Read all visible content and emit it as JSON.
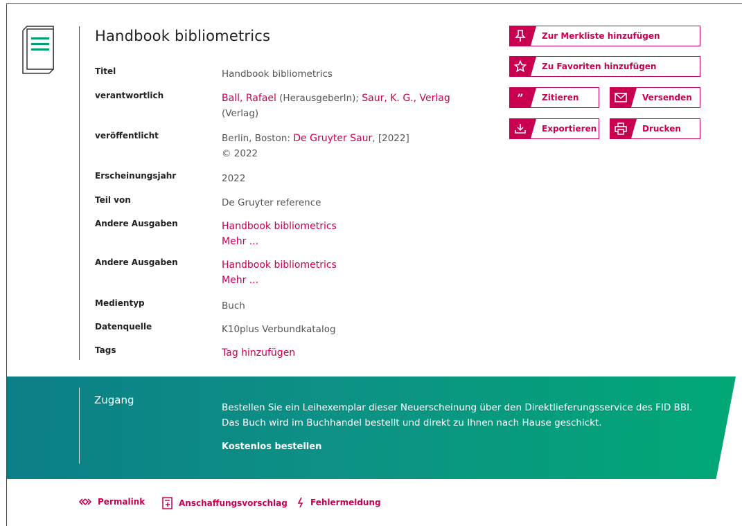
{
  "record": {
    "title": "Handbook bibliometrics",
    "rows": [
      {
        "label": "Titel",
        "value": "Handbook bibliometrics"
      },
      {
        "label": "verantwortlich",
        "link1": "Ball, Rafael",
        "text1": " (HerausgeberIn); ",
        "link2": "Saur, K. G., Verlag",
        "text2": "(Verlag)"
      },
      {
        "label": "veröffentlicht",
        "text1": "Berlin, Boston: ",
        "link1": "De Gruyter Saur",
        "text2": ", [2022]",
        "line2": "© 2022"
      },
      {
        "label": "Erscheinungsjahr",
        "value": "2022"
      },
      {
        "label": "Teil von",
        "value": "De Gruyter reference"
      },
      {
        "label": "Andere Ausgaben",
        "link": "Handbook bibliometrics",
        "more": "Mehr ..."
      },
      {
        "label": "Andere Ausgaben",
        "link": "Handbook bibliometrics",
        "more": "Mehr ..."
      },
      {
        "label": "Medientyp",
        "value": "Buch"
      },
      {
        "label": "Datenquelle",
        "value": "K10plus Verbundkatalog"
      },
      {
        "label": "Tags",
        "link": "Tag hinzufügen"
      }
    ]
  },
  "actions": {
    "merkliste": "Zur Merkliste hinzufügen",
    "favoriten": "Zu Favoriten hinzufügen",
    "zitieren": "Zitieren",
    "versenden": "Versenden",
    "exportieren": "Exportieren",
    "drucken": "Drucken"
  },
  "access": {
    "heading": "Zugang",
    "text": "Bestellen Sie ein Leihexemplar dieser Neuerscheinung über den Direktlieferungsservice des FID BBI. Das Buch wird im Buchhandel bestellt und direkt zu Ihnen nach Hause geschickt.",
    "link": "Kostenlos bestellen"
  },
  "footer": {
    "permalink": "Permalink",
    "anschaffung": "Anschaffungsvorschlag",
    "fehler": "Fehlermeldung"
  },
  "colors": {
    "accent": "#c8004f",
    "band_start": "#0b7f86",
    "band_end": "#00a875",
    "icon_green": "#00a06e"
  }
}
